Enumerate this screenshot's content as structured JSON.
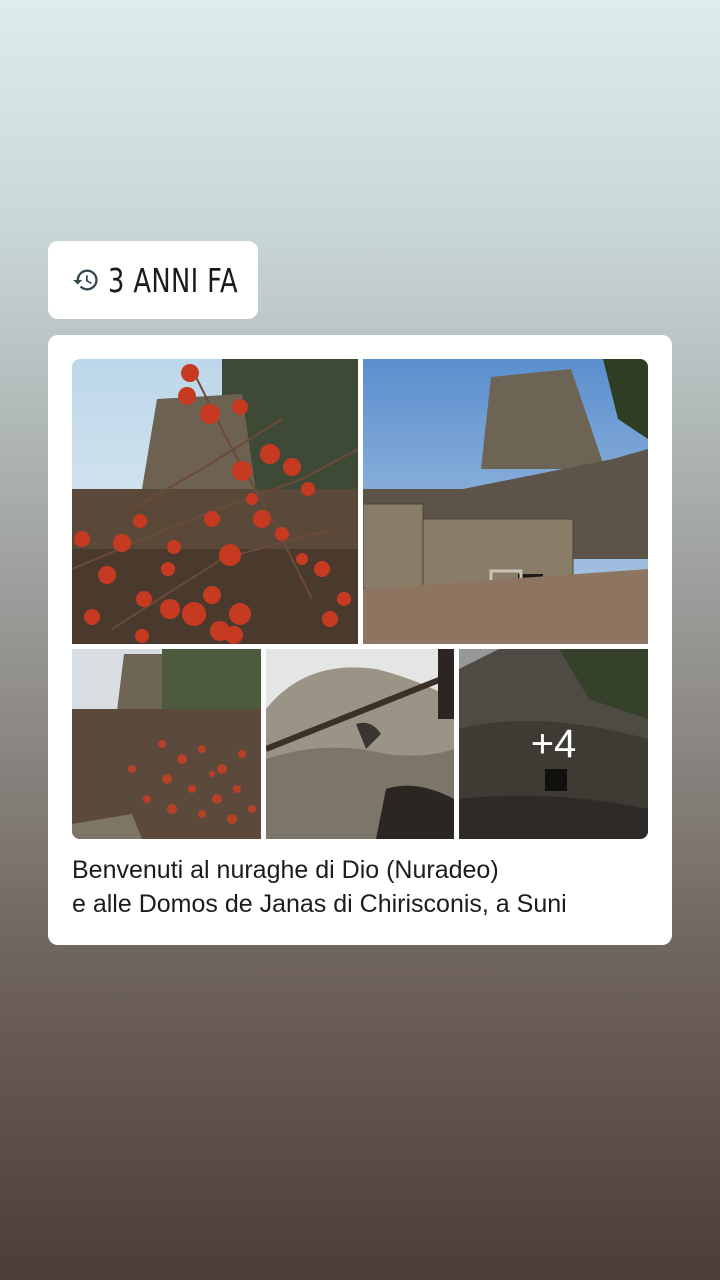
{
  "memory": {
    "label": "3 ANNI FA",
    "icon": "history-icon"
  },
  "post": {
    "caption_line1": "Benvenuti al nuraghe di Dio (Nuradeo)",
    "caption_line2": "e alle Domos de Janas di Chirisconis, a Suni",
    "photos": [
      {
        "subject": "red berries in front of nuraghe tower"
      },
      {
        "subject": "nuraghe stone tower with doorway"
      },
      {
        "subject": "berry bush and tower ruins"
      },
      {
        "subject": "large boulder with metal railing"
      },
      {
        "subject": "rock-cut tomb (domus de janas)"
      }
    ],
    "more_count": "+4"
  }
}
